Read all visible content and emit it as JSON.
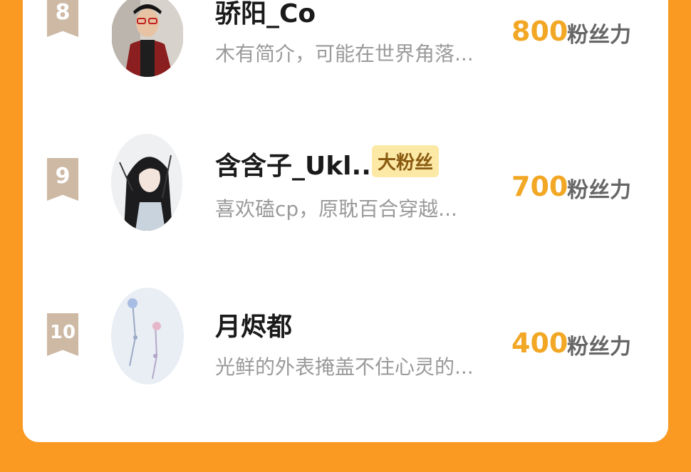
{
  "rankings": [
    {
      "rank": "8",
      "name": "骄阳_Co",
      "bio": "木有简介，可能在世界角落...",
      "badge": "",
      "score": "800",
      "unit": "粉丝力",
      "avatar_icon": "avatar-man-cap-glasses"
    },
    {
      "rank": "9",
      "name": "含含子_Ukl...",
      "bio": "喜欢磕cp，原耽百合穿越...",
      "badge": "大粉丝",
      "score": "700",
      "unit": "粉丝力",
      "avatar_icon": "avatar-anime-longhair"
    },
    {
      "rank": "10",
      "name": "月烬都",
      "bio": "光鲜的外表掩盖不住心灵的...",
      "badge": "",
      "score": "400",
      "unit": "粉丝力",
      "avatar_icon": "avatar-pastel-flowers"
    }
  ],
  "colors": {
    "accent": "#FA9A22",
    "score": "#F2A725",
    "rank_ribbon": "#CDB9A4",
    "badge_bg": "#FCE9A6"
  }
}
